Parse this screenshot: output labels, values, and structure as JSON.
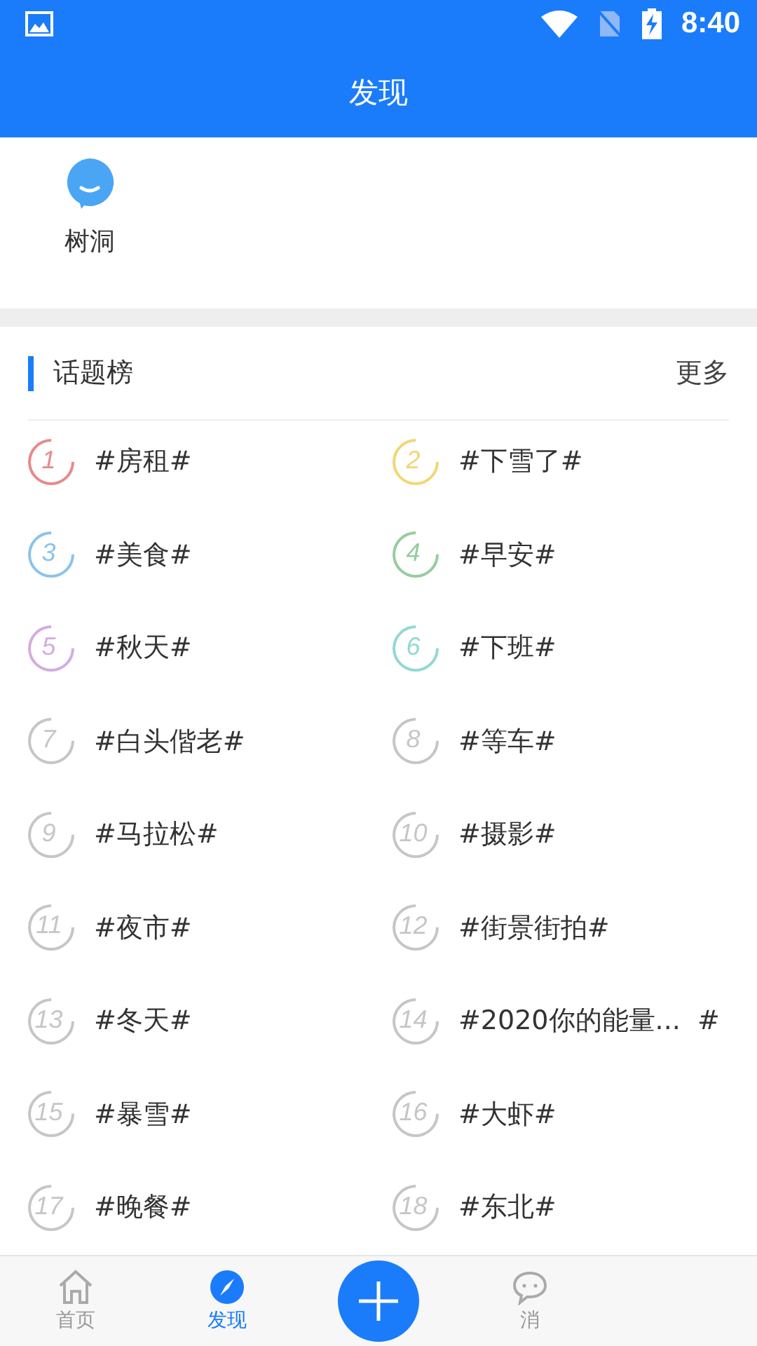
{
  "status_bar": {
    "time": "8:40"
  },
  "header": {
    "title": "发现"
  },
  "shortcuts": [
    {
      "label": "树洞"
    }
  ],
  "topics": {
    "title": "话题榜",
    "more": "更多",
    "items": [
      {
        "rank": "1",
        "name": "#房租#",
        "color": "#e88a8a"
      },
      {
        "rank": "2",
        "name": "#下雪了#",
        "color": "#f2d675"
      },
      {
        "rank": "3",
        "name": "#美食#",
        "color": "#8cc3ec"
      },
      {
        "rank": "4",
        "name": "#早安#",
        "color": "#97cc9f"
      },
      {
        "rank": "5",
        "name": "#秋天#",
        "color": "#d4acdf"
      },
      {
        "rank": "6",
        "name": "#下班#",
        "color": "#93d8d3"
      },
      {
        "rank": "7",
        "name": "#白头偕老#",
        "color": "#c6c6c6"
      },
      {
        "rank": "8",
        "name": "#等车#",
        "color": "#c6c6c6"
      },
      {
        "rank": "9",
        "name": "#马拉松#",
        "color": "#c6c6c6"
      },
      {
        "rank": "10",
        "name": "#摄影#",
        "color": "#c6c6c6"
      },
      {
        "rank": "11",
        "name": "#夜市#",
        "color": "#c6c6c6"
      },
      {
        "rank": "12",
        "name": "#街景街拍#",
        "color": "#c6c6c6"
      },
      {
        "rank": "13",
        "name": "#冬天#",
        "color": "#c6c6c6"
      },
      {
        "rank": "14",
        "name": "#2020你的能量...  #",
        "color": "#c6c6c6"
      },
      {
        "rank": "15",
        "name": "#暴雪#",
        "color": "#c6c6c6"
      },
      {
        "rank": "16",
        "name": "#大虾#",
        "color": "#c6c6c6"
      },
      {
        "rank": "17",
        "name": "#晚餐#",
        "color": "#c6c6c6"
      },
      {
        "rank": "18",
        "name": "#东北#",
        "color": "#c6c6c6"
      }
    ]
  },
  "nav": [
    {
      "kind": "home",
      "label": "首页",
      "selected": false
    },
    {
      "kind": "discover",
      "label": "发现",
      "selected": true
    },
    {
      "kind": "add"
    },
    {
      "kind": "message",
      "label": "消",
      "selected": false
    }
  ]
}
